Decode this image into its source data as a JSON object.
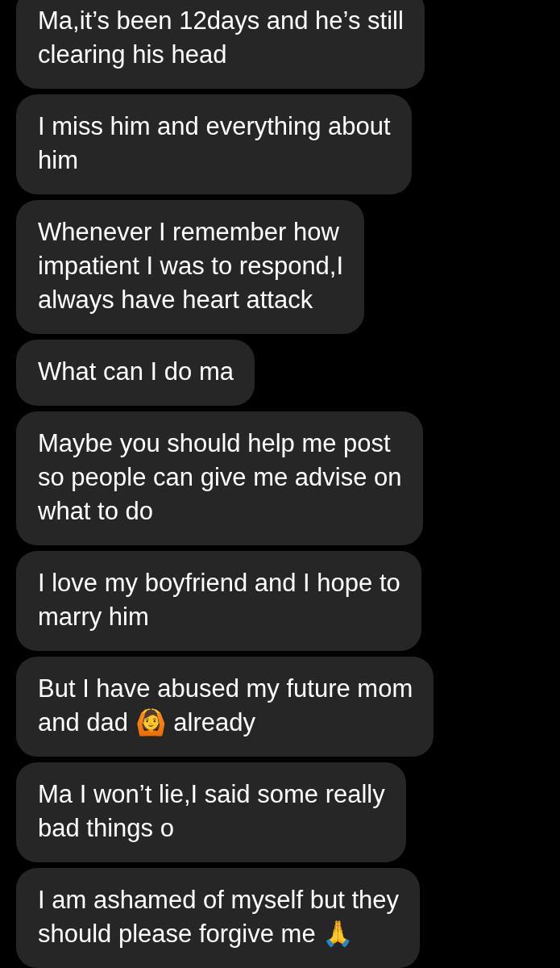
{
  "messages": [
    {
      "lines": [
        "Ma,it’s been 12days and he’s still",
        "clearing his head"
      ]
    },
    {
      "lines": [
        "I miss him and everything about",
        "him"
      ]
    },
    {
      "lines": [
        "Whenever I remember how",
        "impatient I was to respond,I",
        "always have heart attack"
      ]
    },
    {
      "lines": [
        "What can I do ma"
      ]
    },
    {
      "lines": [
        "Maybe you should help me post",
        "so people can give me advise on",
        "what to do"
      ]
    },
    {
      "lines": [
        "I love my boyfriend and I hope to",
        "marry him"
      ]
    },
    {
      "lines": [
        "But I have abused my future mom",
        "and dad 🙆 already"
      ]
    },
    {
      "lines": [
        "Ma I won’t lie,I said some really",
        "bad things o"
      ]
    },
    {
      "lines": [
        "I am ashamed of myself but they",
        "should please forgive me 🙏"
      ]
    }
  ]
}
